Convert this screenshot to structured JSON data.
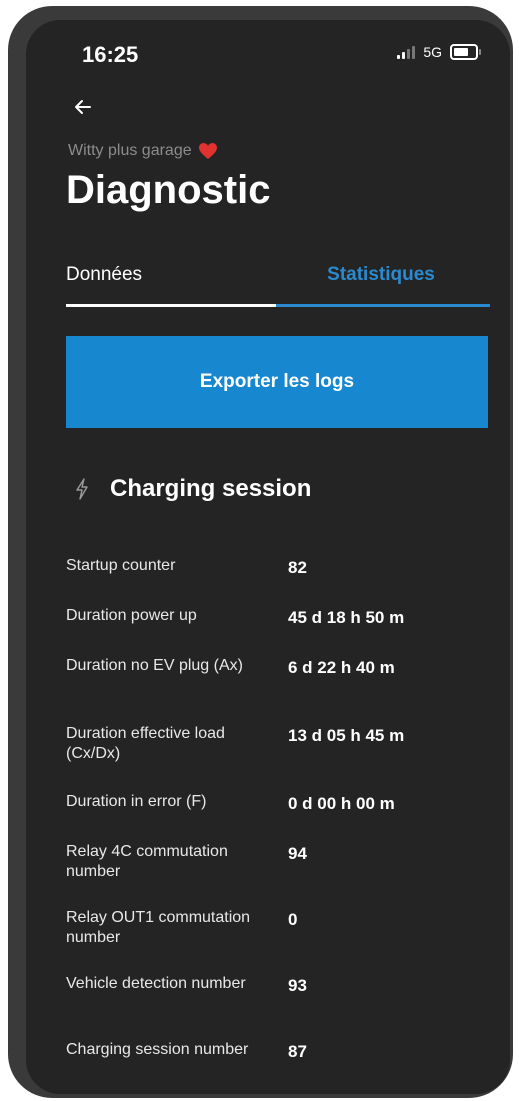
{
  "status_bar": {
    "time": "16:25",
    "network": "5G"
  },
  "header": {
    "subtitle": "Witty plus garage",
    "title": "Diagnostic"
  },
  "tabs": [
    {
      "label": "Données",
      "active": false
    },
    {
      "label": "Statistiques",
      "active": true
    }
  ],
  "export_button": {
    "label": "Exporter les logs"
  },
  "section": {
    "title": "Charging session",
    "icon": "bolt-icon"
  },
  "stats": [
    {
      "label": "Startup counter",
      "value": "82"
    },
    {
      "label": "Duration power up",
      "value": "45 d 18 h 50 m"
    },
    {
      "label": "Duration no EV plug (Ax)",
      "value": "6 d 22 h 40 m"
    },
    {
      "label": "Duration effective load (Cx/Dx)",
      "value": "13 d 05 h 45 m"
    },
    {
      "label": "Duration in error (F)",
      "value": "0 d 00 h 00 m"
    },
    {
      "label": "Relay 4C commutation number",
      "value": "94"
    },
    {
      "label": "Relay OUT1 commutation number",
      "value": "0"
    },
    {
      "label": "Vehicle detection number",
      "value": "93"
    },
    {
      "label": "Charging session number",
      "value": "87"
    }
  ],
  "colors": {
    "accent": "#1787cf",
    "active_tab": "#2a8ad0",
    "background": "#242424",
    "heart": "#e0322f"
  }
}
